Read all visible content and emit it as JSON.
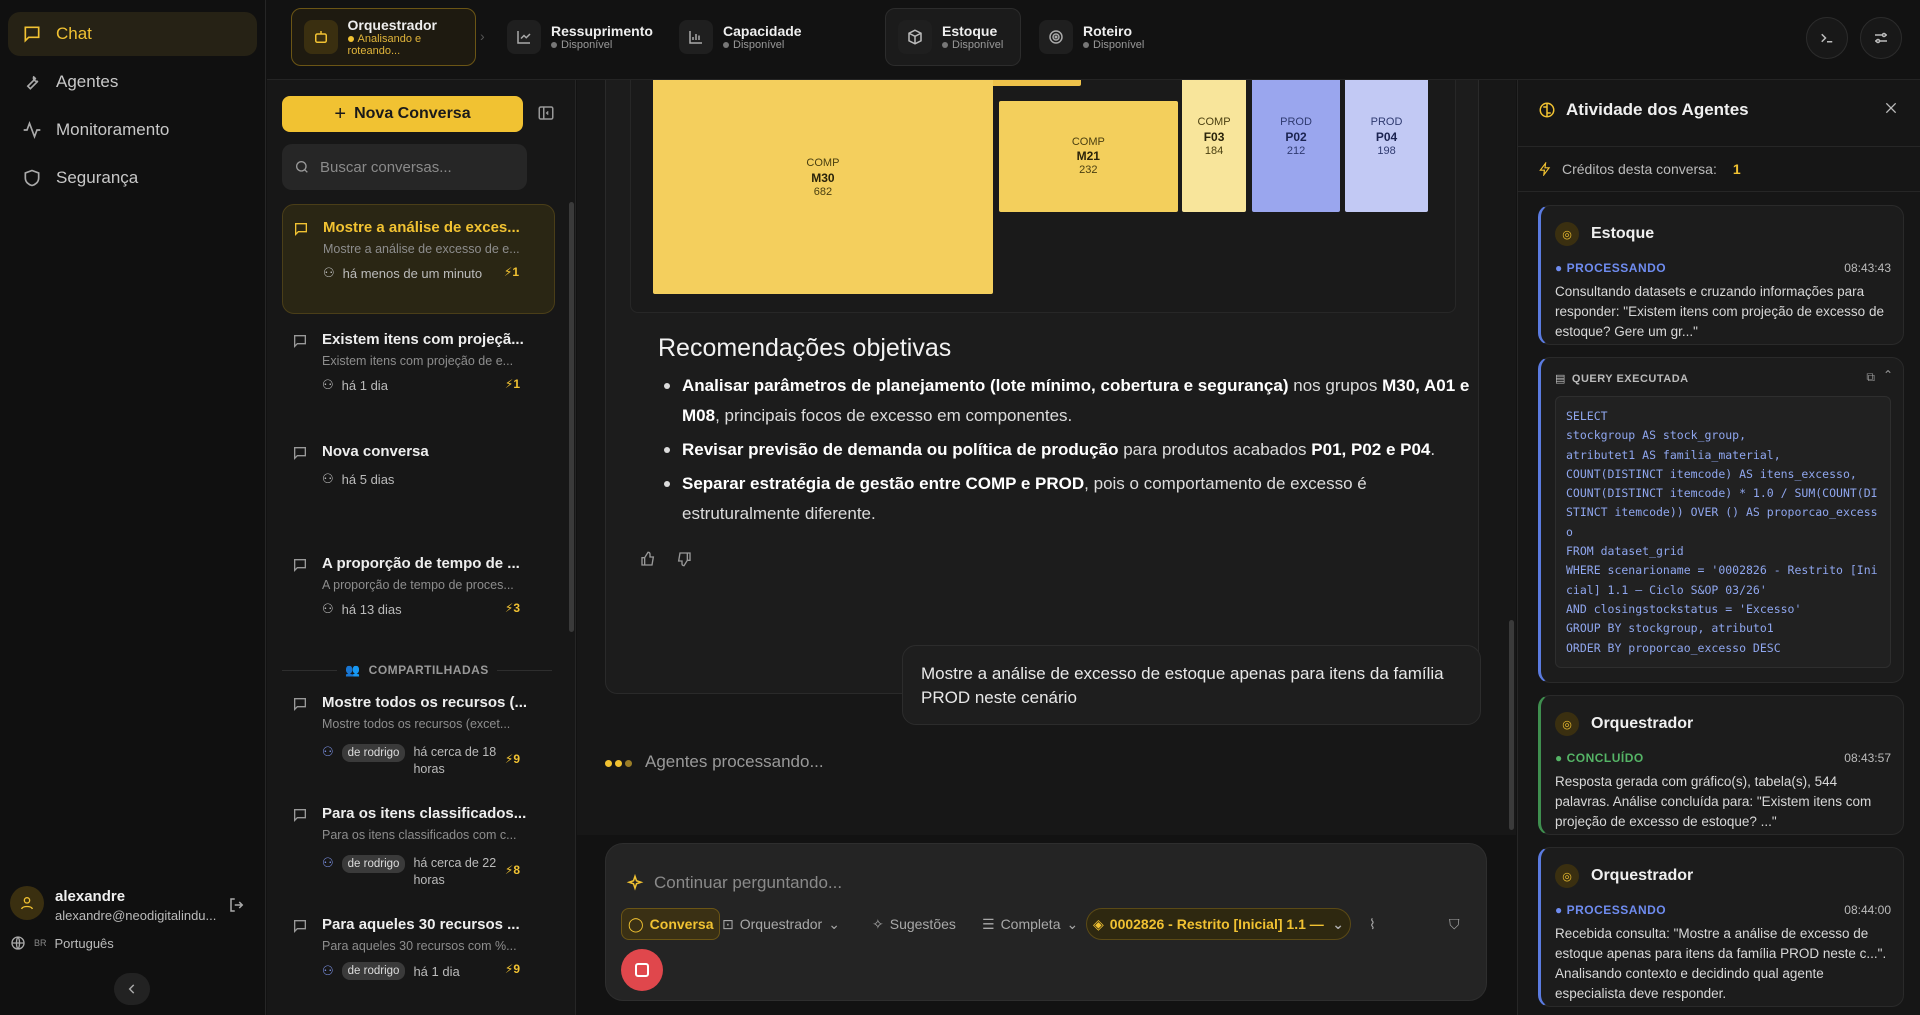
{
  "nav": {
    "items": [
      {
        "label": "Chat",
        "icon": "chat-icon"
      },
      {
        "label": "Agentes",
        "icon": "wrench-icon"
      },
      {
        "label": "Monitoramento",
        "icon": "activity-icon"
      },
      {
        "label": "Segurança",
        "icon": "shield-icon"
      }
    ]
  },
  "user": {
    "name": "alexandre",
    "email": "alexandre@neodigitalindu...",
    "language_flag": "BR",
    "language": "Português"
  },
  "agents": [
    {
      "name": "Orquestrador",
      "status": "Analisando e roteando..."
    },
    {
      "name": "Ressuprimento",
      "status": "Disponível"
    },
    {
      "name": "Capacidade",
      "status": "Disponível"
    },
    {
      "name": "Estoque",
      "status": "Disponível"
    },
    {
      "name": "Roteiro",
      "status": "Disponível"
    }
  ],
  "sidebar": {
    "new_conversation": "Nova Conversa",
    "search_placeholder": "Buscar conversas...",
    "conversations": [
      {
        "title": "Mostre a análise de exces...",
        "subtitle": "Mostre a análise de excesso de e...",
        "time": "há menos de um minuto",
        "credits": "1"
      },
      {
        "title": "Existem itens com projeçã...",
        "subtitle": "Existem itens com projeção de e...",
        "time": "há 1 dia",
        "credits": "1"
      },
      {
        "title": "Nova conversa",
        "subtitle": "",
        "time": "há 5 dias",
        "credits": ""
      },
      {
        "title": "A proporção de tempo de ...",
        "subtitle": "A proporção de tempo de proces...",
        "time": "há 13 dias",
        "credits": "3"
      }
    ],
    "shared_header": "COMPARTILHADAS",
    "shared": [
      {
        "title": "Mostre todos os recursos (...",
        "subtitle": "Mostre todos os recursos (excet...",
        "owner": "de rodrigo",
        "time": "há cerca de 18 horas",
        "credits": "9"
      },
      {
        "title": "Para os itens classificados...",
        "subtitle": "Para os itens classificados com c...",
        "owner": "de rodrigo",
        "time": "há cerca de 22 horas",
        "credits": "8"
      },
      {
        "title": "Para aqueles 30 recursos ...",
        "subtitle": "Para aqueles 30 recursos com %...",
        "owner": "de rodrigo",
        "time": "há 1 dia",
        "credits": "9"
      }
    ]
  },
  "chart_data": {
    "type": "treemap",
    "colors": {
      "COMP": "#f4cf5d",
      "PROD": "#9aa6ee"
    },
    "nodes": [
      {
        "group": "COMP",
        "name": "M30",
        "value": 682
      },
      {
        "group": "COMP",
        "name": "M21",
        "value": 232
      },
      {
        "group": "COMP",
        "name": "F03",
        "value": 184
      },
      {
        "group": "PROD",
        "name": "P02",
        "value": 212
      },
      {
        "group": "PROD",
        "name": "P04",
        "value": 198
      }
    ]
  },
  "answer": {
    "rec_title": "Recomendações objetivas",
    "rec1_bold": "Analisar parâmetros de planejamento (lote mínimo, cobertura e segurança)",
    "rec1_mid": " nos grupos ",
    "rec1_bold2": "M30, A01 e M08",
    "rec1_end": ", principais focos de excesso em componentes.",
    "rec2_bold": "Revisar previsão de demanda ou política de produção",
    "rec2_mid": " para produtos acabados ",
    "rec2_bold2": "P01, P02 e P04",
    "rec2_end": ".",
    "rec3_bold": "Separar estratégia de gestão entre COMP e PROD",
    "rec3_end": ", pois o comportamento de excesso é estruturalmente diferente."
  },
  "user_message": "Mostre a análise de excesso de estoque apenas para itens da família PROD neste cenário",
  "processing": "Agentes processando...",
  "composer": {
    "placeholder": "Continuar perguntando...",
    "mode": "Conversa",
    "agent": "Orquestrador",
    "suggestions": "Sugestões",
    "depth": "Completa",
    "scenario": "0002826 - Restrito [Inicial] 1.1 — ..."
  },
  "activity": {
    "title": "Atividade dos Agentes",
    "credits_label": "Créditos desta conversa:",
    "credits_value": "1",
    "cards": [
      {
        "agent": "Estoque",
        "status": "PROCESSANDO",
        "time": "08:43:43",
        "body": "Consultando datasets e cruzando informações para responder: \"Existem itens com projeção de excesso de estoque? Gere um gr...\""
      },
      {
        "agent": "Orquestrador",
        "status": "CONCLUÍDO",
        "time": "08:43:57",
        "body": "Resposta gerada com gráfico(s), tabela(s), 544 palavras. Análise concluída para: \"Existem itens com projeção de excesso de estoque? ...\""
      },
      {
        "agent": "Orquestrador",
        "status": "PROCESSANDO",
        "time": "08:44:00",
        "body": "Recebida consulta: \"Mostre a análise de excesso de estoque apenas para itens da família PROD neste c...\". Analisando contexto e decidindo qual agente especialista deve responder."
      }
    ],
    "query_label": "QUERY EXECUTADA",
    "query": "SELECT\nstockgroup AS stock_group,\natributet1 AS familia_material,\nCOUNT(DISTINCT itemcode) AS itens_excesso,\nCOUNT(DISTINCT itemcode) * 1.0 / SUM(COUNT(DISTINCT itemcode)) OVER () AS proporcao_excesso\nFROM dataset_grid\nWHERE scenarioname = '0002826 - Restrito [Inicial] 1.1 — Ciclo S&OP 03/26'\nAND closingstockstatus = 'Excesso'\nGROUP BY stockgroup, atributo1\nORDER BY proporcao_excesso DESC"
  }
}
